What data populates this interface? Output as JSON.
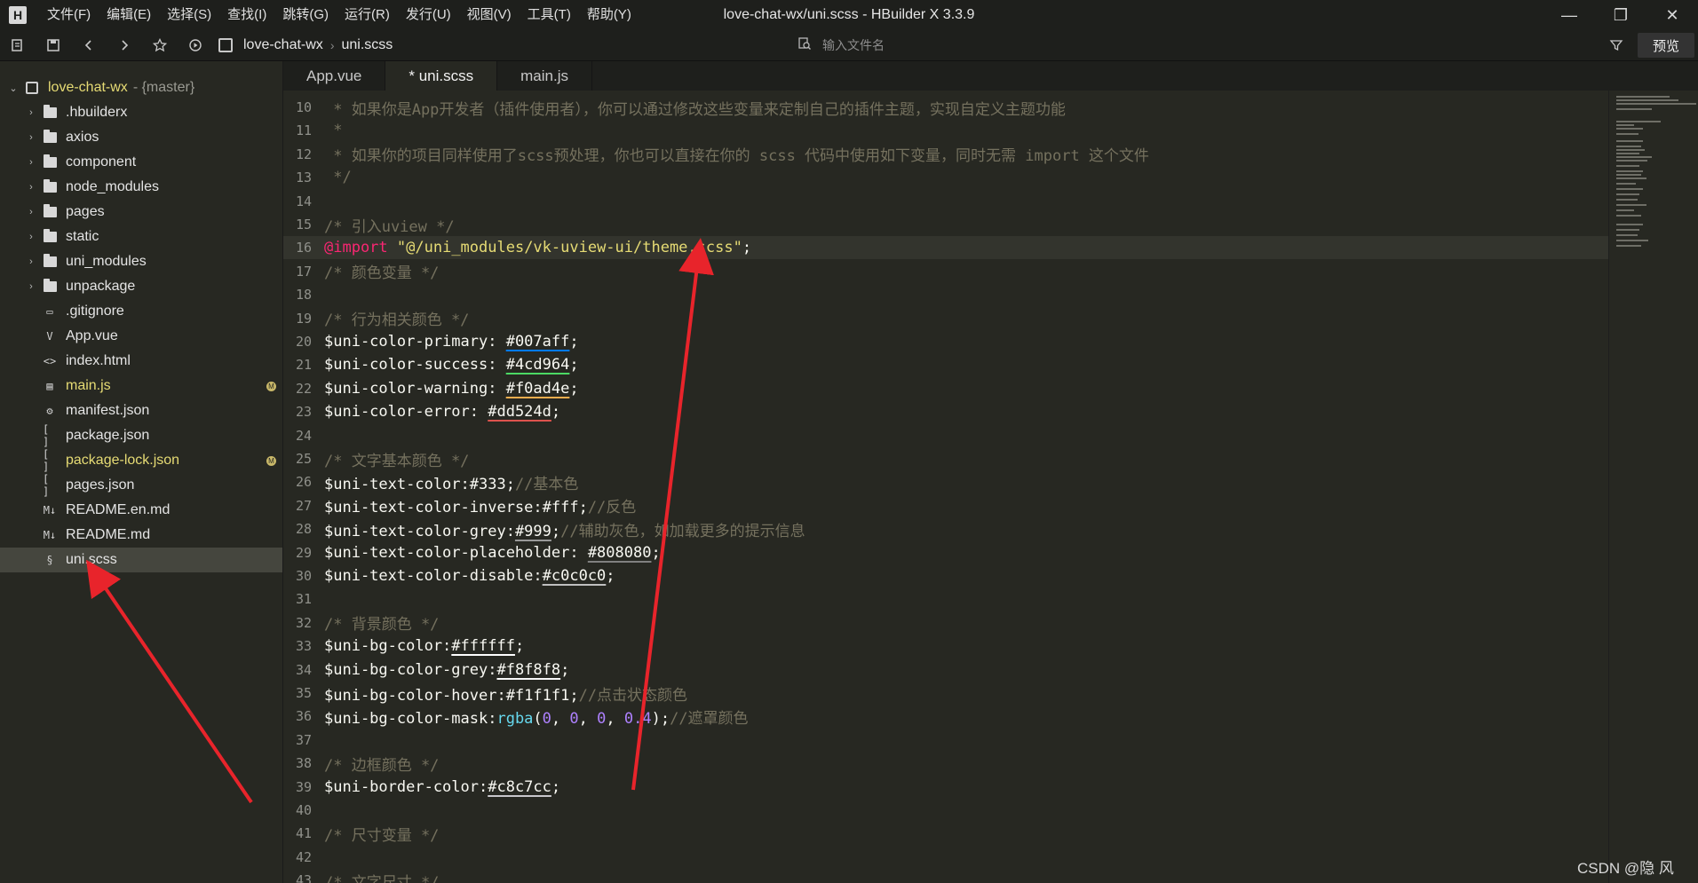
{
  "titlebar": {
    "title": "love-chat-wx/uni.scss - HBuilder X 3.3.9",
    "logo": "H",
    "menu": [
      "文件(F)",
      "编辑(E)",
      "选择(S)",
      "查找(I)",
      "跳转(G)",
      "运行(R)",
      "发行(U)",
      "视图(V)",
      "工具(T)",
      "帮助(Y)"
    ],
    "controls": {
      "minimize": "—",
      "restore": "❐",
      "close": "✕"
    }
  },
  "toolbar": {
    "breadcrumb": [
      "love-chat-wx",
      "uni.scss"
    ],
    "search_placeholder": "输入文件名",
    "preview_label": "预览"
  },
  "sidebar": {
    "project": {
      "name": "love-chat-wx",
      "branch": "- {master}"
    },
    "items": [
      {
        "label": ".hbuilderx",
        "type": "folder"
      },
      {
        "label": "axios",
        "type": "folder"
      },
      {
        "label": "component",
        "type": "folder"
      },
      {
        "label": "node_modules",
        "type": "folder"
      },
      {
        "label": "pages",
        "type": "folder"
      },
      {
        "label": "static",
        "type": "folder"
      },
      {
        "label": "uni_modules",
        "type": "folder"
      },
      {
        "label": "unpackage",
        "type": "folder"
      },
      {
        "label": ".gitignore",
        "type": "file",
        "icon": "▭"
      },
      {
        "label": "App.vue",
        "type": "file",
        "icon": "V"
      },
      {
        "label": "index.html",
        "type": "file",
        "icon": "<>"
      },
      {
        "label": "main.js",
        "type": "file",
        "icon": "▤",
        "modified": true,
        "badge": "M"
      },
      {
        "label": "manifest.json",
        "type": "file",
        "icon": "⚙"
      },
      {
        "label": "package.json",
        "type": "file",
        "icon": "[ ]"
      },
      {
        "label": "package-lock.json",
        "type": "file",
        "icon": "[ ]",
        "modified": true,
        "badge": "M"
      },
      {
        "label": "pages.json",
        "type": "file",
        "icon": "[ ]"
      },
      {
        "label": "README.en.md",
        "type": "file",
        "icon": "M↓"
      },
      {
        "label": "README.md",
        "type": "file",
        "icon": "M↓"
      },
      {
        "label": "uni.scss",
        "type": "file",
        "icon": "§",
        "selected": true
      }
    ]
  },
  "tabs": [
    {
      "label": "App.vue"
    },
    {
      "label": "* uni.scss",
      "active": true
    },
    {
      "label": "main.js"
    }
  ],
  "editor": {
    "lines": [
      {
        "n": "10",
        "parts": [
          [
            "cmt",
            " * 如果你是App开发者（插件使用者），你可以通过修改这些变量来定制自己的插件主题，实现自定义主题功能"
          ]
        ]
      },
      {
        "n": "11",
        "parts": [
          [
            "cmt",
            " *"
          ]
        ]
      },
      {
        "n": "12",
        "parts": [
          [
            "cmt",
            " * 如果你的项目同样使用了scss预处理，你也可以直接在你的 scss 代码中使用如下变量，同时无需 import 这个文件"
          ]
        ]
      },
      {
        "n": "13",
        "parts": [
          [
            "cmt",
            " */"
          ]
        ]
      },
      {
        "n": "14",
        "parts": []
      },
      {
        "n": "15",
        "parts": [
          [
            "cmt",
            "/* 引入uview */"
          ]
        ]
      },
      {
        "n": "16",
        "current": true,
        "parts": [
          [
            "at",
            "@import"
          ],
          [
            "plain",
            " "
          ],
          [
            "str",
            "\"@/uni_modules/vk-uview-ui/theme.scss\""
          ],
          [
            "plain",
            ";"
          ]
        ]
      },
      {
        "n": "17",
        "parts": [
          [
            "cmt",
            "/* 颜色变量 */"
          ]
        ]
      },
      {
        "n": "18",
        "parts": []
      },
      {
        "n": "19",
        "parts": [
          [
            "cmt",
            "/* 行为相关颜色 */"
          ]
        ]
      },
      {
        "n": "20",
        "parts": [
          [
            "plain",
            "$uni-color-primary: "
          ],
          [
            "sw:#007aff",
            "#007aff"
          ],
          [
            "plain",
            ";"
          ]
        ]
      },
      {
        "n": "21",
        "parts": [
          [
            "plain",
            "$uni-color-success: "
          ],
          [
            "sw:#4cd964",
            "#4cd964"
          ],
          [
            "plain",
            ";"
          ]
        ]
      },
      {
        "n": "22",
        "parts": [
          [
            "plain",
            "$uni-color-warning: "
          ],
          [
            "sw:#f0ad4e",
            "#f0ad4e"
          ],
          [
            "plain",
            ";"
          ]
        ]
      },
      {
        "n": "23",
        "parts": [
          [
            "plain",
            "$uni-color-error: "
          ],
          [
            "sw:#dd524d",
            "#dd524d"
          ],
          [
            "plain",
            ";"
          ]
        ]
      },
      {
        "n": "24",
        "parts": []
      },
      {
        "n": "25",
        "parts": [
          [
            "cmt",
            "/* 文字基本颜色 */"
          ]
        ]
      },
      {
        "n": "26",
        "parts": [
          [
            "plain",
            "$uni-text-color:#333;"
          ],
          [
            "cmt",
            "//基本色"
          ]
        ]
      },
      {
        "n": "27",
        "parts": [
          [
            "plain",
            "$uni-text-color-inverse:#fff;"
          ],
          [
            "cmt",
            "//反色"
          ]
        ]
      },
      {
        "n": "28",
        "parts": [
          [
            "plain",
            "$uni-text-color-grey:"
          ],
          [
            "sw:#999999",
            "#999"
          ],
          [
            "plain",
            ";"
          ],
          [
            "cmt",
            "//辅助灰色，如加载更多的提示信息"
          ]
        ]
      },
      {
        "n": "29",
        "parts": [
          [
            "plain",
            "$uni-text-color-placeholder: "
          ],
          [
            "sw:#808080",
            "#808080"
          ],
          [
            "plain",
            ";"
          ]
        ]
      },
      {
        "n": "30",
        "parts": [
          [
            "plain",
            "$uni-text-color-disable:"
          ],
          [
            "sw:#c0c0c0",
            "#c0c0c0"
          ],
          [
            "plain",
            ";"
          ]
        ]
      },
      {
        "n": "31",
        "parts": []
      },
      {
        "n": "32",
        "parts": [
          [
            "cmt",
            "/* 背景颜色 */"
          ]
        ]
      },
      {
        "n": "33",
        "parts": [
          [
            "plain",
            "$uni-bg-color:"
          ],
          [
            "sw:#ffffff",
            "#ffffff"
          ],
          [
            "plain",
            ";"
          ]
        ]
      },
      {
        "n": "34",
        "parts": [
          [
            "plain",
            "$uni-bg-color-grey:"
          ],
          [
            "sw:#f8f8f8",
            "#f8f8f8"
          ],
          [
            "plain",
            ";"
          ]
        ]
      },
      {
        "n": "35",
        "parts": [
          [
            "plain",
            "$uni-bg-color-hover:#f1f1f1;"
          ],
          [
            "cmt",
            "//点击状态颜色"
          ]
        ]
      },
      {
        "n": "36",
        "parts": [
          [
            "plain",
            "$uni-bg-color-mask:"
          ],
          [
            "fn",
            "rgba"
          ],
          [
            "plain",
            "("
          ],
          [
            "num",
            "0"
          ],
          [
            "plain",
            ", "
          ],
          [
            "num",
            "0"
          ],
          [
            "plain",
            ", "
          ],
          [
            "num",
            "0"
          ],
          [
            "plain",
            ", "
          ],
          [
            "num",
            "0.4"
          ],
          [
            "plain",
            ");"
          ],
          [
            "cmt",
            "//遮罩颜色"
          ]
        ]
      },
      {
        "n": "37",
        "parts": []
      },
      {
        "n": "38",
        "parts": [
          [
            "cmt",
            "/* 边框颜色 */"
          ]
        ]
      },
      {
        "n": "39",
        "parts": [
          [
            "plain",
            "$uni-border-color:"
          ],
          [
            "sw:#c8c7cc",
            "#c8c7cc"
          ],
          [
            "plain",
            ";"
          ]
        ]
      },
      {
        "n": "40",
        "parts": []
      },
      {
        "n": "41",
        "parts": [
          [
            "cmt",
            "/* 尺寸变量 */"
          ]
        ]
      },
      {
        "n": "42",
        "parts": []
      },
      {
        "n": "43",
        "parts": [
          [
            "cmt",
            "/* 文字尺寸 */"
          ]
        ]
      }
    ]
  },
  "watermark": "CSDN @隐 风",
  "colors": {
    "annotation_arrow": "#e8242b"
  }
}
